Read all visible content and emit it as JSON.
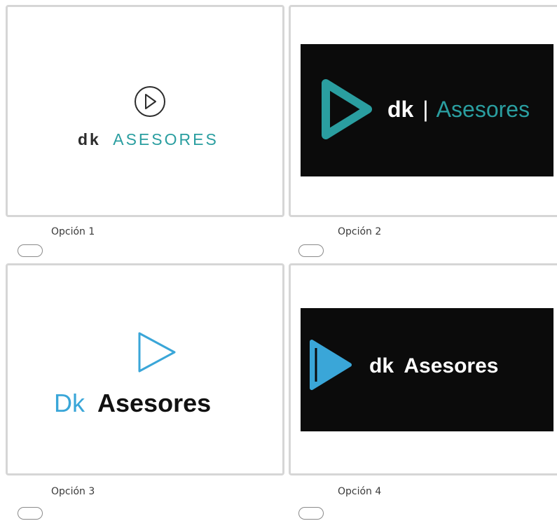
{
  "options": [
    {
      "caption": "Opción 1",
      "logo": {
        "dk": "dk",
        "name": "ASESORES"
      }
    },
    {
      "caption": "Opción 2",
      "logo": {
        "dk": "dk",
        "separator": "|",
        "name": "Asesores"
      }
    },
    {
      "caption": "Opción 3",
      "logo": {
        "dk": "Dk",
        "name": "Asesores"
      }
    },
    {
      "caption": "Opción 4",
      "logo": {
        "dk": "dk",
        "name": "Asesores"
      }
    }
  ],
  "colors": {
    "teal": "#2a9ea0",
    "blue": "#3aa6d8",
    "dark": "#2c2c2c",
    "panel": "#0b0b0b"
  }
}
